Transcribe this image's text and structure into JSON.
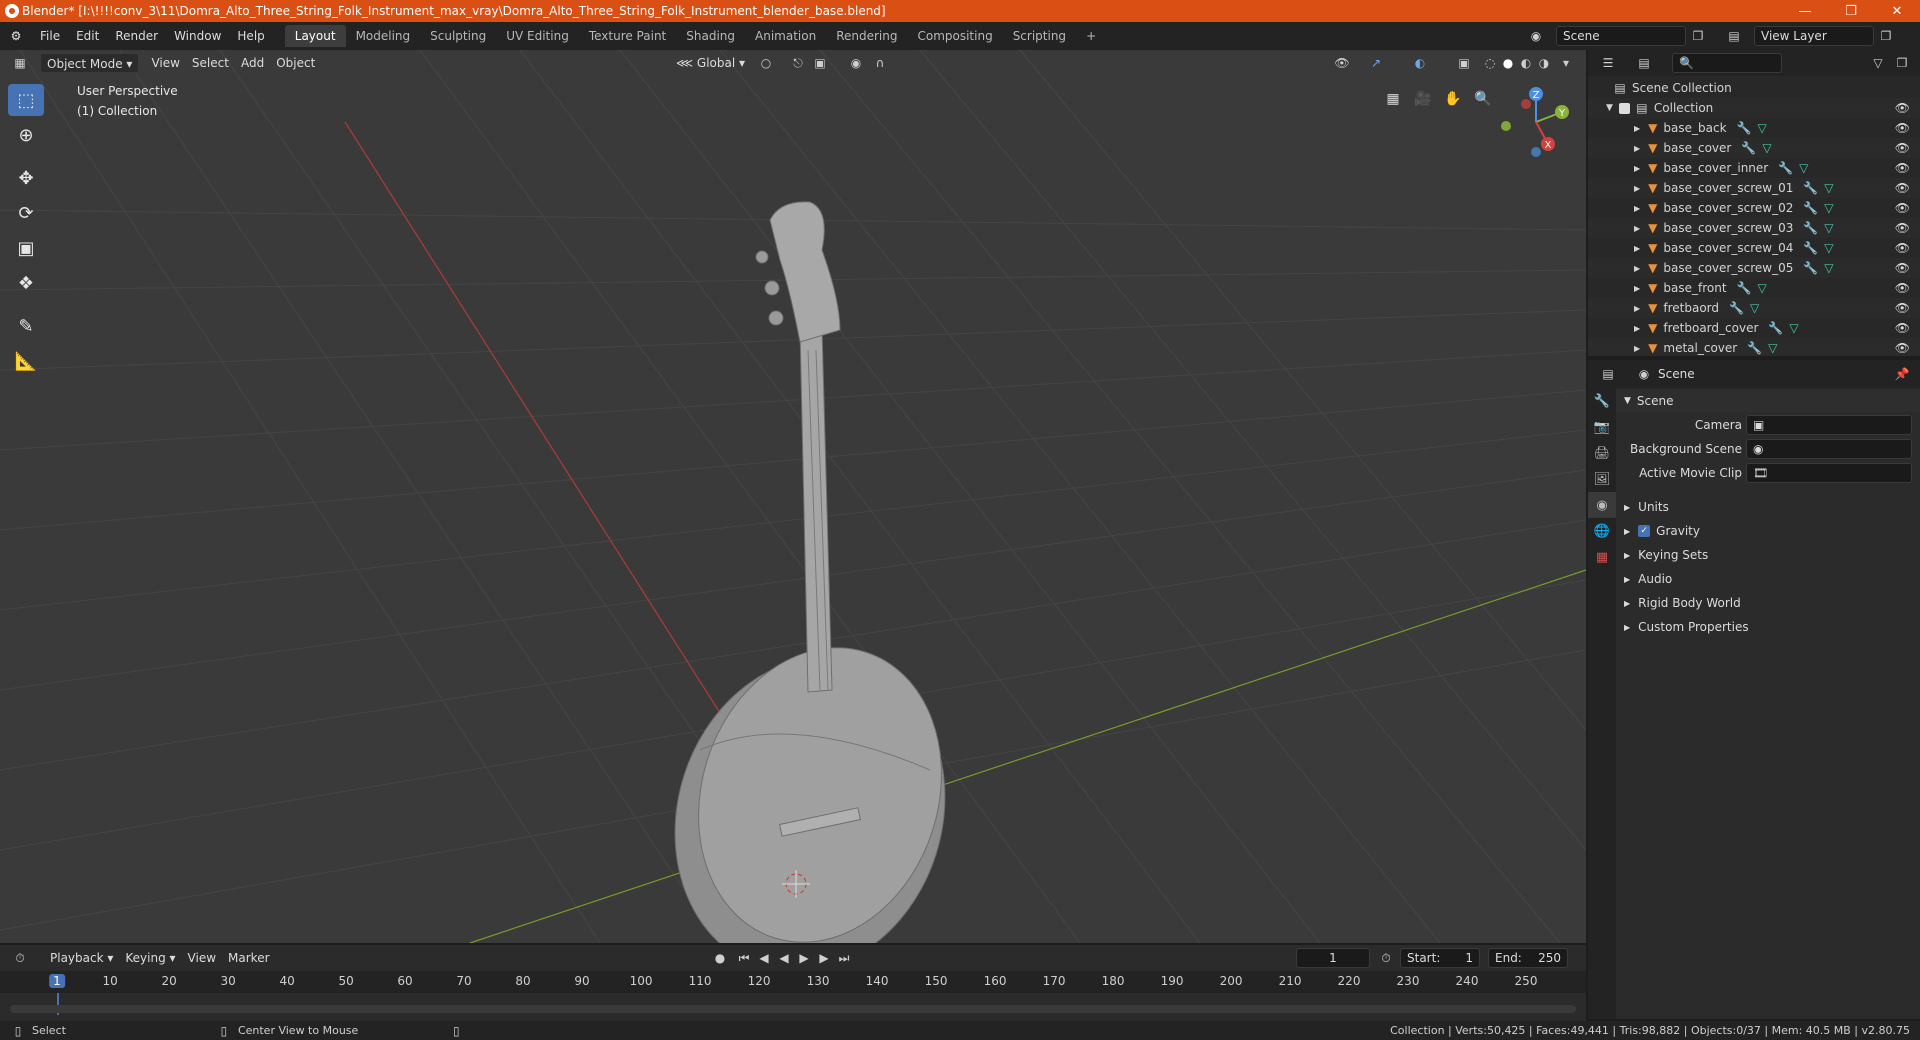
{
  "window": {
    "title": "Blender* [I:\\!!!!conv_3\\11\\Domra_Alto_Three_String_Folk_Instrument_max_vray\\Domra_Alto_Three_String_Folk_Instrument_blender_base.blend]",
    "accent": "#d94f14"
  },
  "menu": {
    "items": [
      "File",
      "Edit",
      "Render",
      "Window",
      "Help"
    ],
    "workspaces": [
      "Layout",
      "Modeling",
      "Sculpting",
      "UV Editing",
      "Texture Paint",
      "Shading",
      "Animation",
      "Rendering",
      "Compositing",
      "Scripting"
    ],
    "active_workspace": "Layout",
    "add_tab": "+",
    "scene": "Scene",
    "view_layer": "View Layer"
  },
  "viewport": {
    "mode": "Object Mode",
    "menus": [
      "View",
      "Select",
      "Add",
      "Object"
    ],
    "orientation": "Global",
    "perspective_label": "User Perspective",
    "collection_label": "(1) Collection",
    "axes": {
      "x": "X",
      "y": "Y",
      "z": "Z"
    },
    "colors": {
      "x_axis": "#b03a3a",
      "y_axis": "#7a9a2a",
      "background": "#3a3a3a",
      "active_tool": "#4772b3"
    }
  },
  "outliner": {
    "root": "Scene Collection",
    "collection": "Collection",
    "objects": [
      "base_back",
      "base_cover",
      "base_cover_inner",
      "base_cover_screw_01",
      "base_cover_screw_02",
      "base_cover_screw_03",
      "base_cover_screw_04",
      "base_cover_screw_05",
      "base_front",
      "fretbaord",
      "fretboard_cover",
      "metal_cover"
    ]
  },
  "properties": {
    "header": "Scene",
    "section": "Scene",
    "camera_label": "Camera",
    "background_scene_label": "Background Scene",
    "active_movie_clip_label": "Active Movie Clip",
    "panels": [
      "Units",
      "Gravity",
      "Keying Sets",
      "Audio",
      "Rigid Body World",
      "Custom Properties"
    ],
    "gravity_checked": true
  },
  "timeline": {
    "menus": [
      "Playback",
      "Keying",
      "View",
      "Marker"
    ],
    "current_frame": "1",
    "start_label": "Start:",
    "start": "1",
    "end_label": "End:",
    "end": "250",
    "ticks": [
      "1",
      "10",
      "20",
      "30",
      "40",
      "50",
      "60",
      "70",
      "80",
      "90",
      "100",
      "110",
      "120",
      "130",
      "140",
      "150",
      "160",
      "170",
      "180",
      "190",
      "200",
      "210",
      "220",
      "230",
      "240",
      "250"
    ]
  },
  "statusbar": {
    "select": "Select",
    "center_view": "Center View to Mouse",
    "stats": "Collection | Verts:50,425 | Faces:49,441 | Tris:98,882 | Objects:0/37 | Mem: 40.5 MB | v2.80.75"
  }
}
